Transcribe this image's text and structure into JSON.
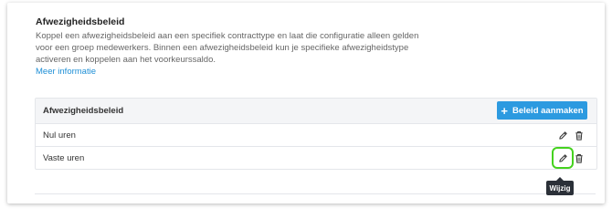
{
  "section": {
    "title": "Afwezigheidsbeleid",
    "description": "Koppel een afwezigheidsbeleid aan een specifiek contracttype en laat die configuratie alleen gelden voor een groep medewerkers. Binnen een afwezigheidsbeleid kun je specifieke afwezigheidstype activeren en koppelen aan het voorkeurssaldo.",
    "more_link": "Meer informatie"
  },
  "table": {
    "header": "Afwezigheidsbeleid",
    "create_button": "Beleid aanmaken",
    "rows": [
      {
        "label": "Nul uren"
      },
      {
        "label": "Vaste uren"
      }
    ]
  },
  "tooltip": "Wijzig",
  "icons": {
    "plus": "plus-icon",
    "edit": "pencil-icon",
    "delete": "trash-icon"
  },
  "colors": {
    "accent": "#2c9ae0",
    "link": "#1e8fd6",
    "highlight": "#45d21f",
    "tooltip_bg": "#2b3038"
  }
}
